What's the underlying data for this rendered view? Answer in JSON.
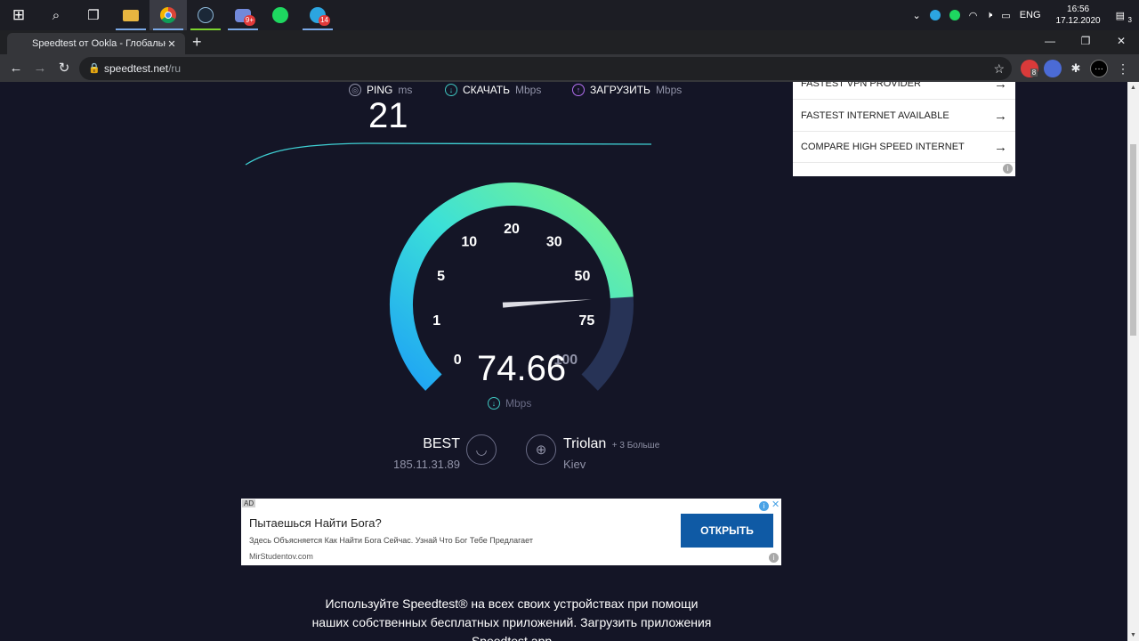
{
  "taskbar": {
    "apps": [
      {
        "name": "windows-start",
        "glyph": "⊞"
      },
      {
        "name": "search",
        "glyph": "⌕"
      },
      {
        "name": "task-view",
        "glyph": "❐"
      },
      {
        "name": "file-explorer",
        "glyph": "▬"
      },
      {
        "name": "chrome",
        "glyph": "◉"
      },
      {
        "name": "steam",
        "glyph": "♨"
      },
      {
        "name": "discord",
        "glyph": "◙",
        "badge": "9+"
      },
      {
        "name": "spotify",
        "glyph": "◍"
      },
      {
        "name": "telegram",
        "glyph": "➤",
        "badge": "14"
      }
    ],
    "tray": {
      "language": "ENG",
      "time": "16:56",
      "date": "17.12.2020",
      "notification_count": "3"
    }
  },
  "browser": {
    "tab_title": "Speedtest от Ookla - Глобальный",
    "url_host": "speedtest.net",
    "url_path": "/ru",
    "extension_badge": "8"
  },
  "speedtest": {
    "ping_label": "PING",
    "ping_unit": "ms",
    "download_label": "СКАЧАТЬ",
    "download_unit": "Mbps",
    "upload_label": "ЗАГРУЗИТЬ",
    "upload_unit": "Mbps",
    "ping_value": "21",
    "gauge_labels": [
      "0",
      "1",
      "5",
      "10",
      "20",
      "30",
      "50",
      "75",
      "100"
    ],
    "speed_value": "74.66",
    "speed_unit": "Mbps",
    "gauge_fill_fraction": 0.82,
    "isp_name": "BEST",
    "isp_ip": "185.11.31.89",
    "server_name": "Triolan",
    "server_more": "+ 3 Больше",
    "server_city": "Kiev"
  },
  "side_ad": {
    "items": [
      {
        "label": "FASTEST VPN PROVIDER"
      },
      {
        "label": "FASTEST INTERNET AVAILABLE"
      },
      {
        "label": "COMPARE HIGH SPEED INTERNET"
      }
    ]
  },
  "banner_ad": {
    "tag": "AD",
    "title": "Пытаешься Найти Бога?",
    "description": "Здесь Объясняется Как Найти Бога Сейчас. Узнай Что Бог Тебе Предлагает",
    "url": "MirStudentov.com",
    "cta": "ОТКРЫТЬ"
  },
  "promo": {
    "line1": "Используйте Speedtest® на всех своих устройствах при помощи",
    "line2": "наших собственных бесплатных приложений. Загрузить приложения",
    "line3": "Speedtest app"
  },
  "colors": {
    "page_bg": "#141526",
    "gauge_start": "#1fa6ff",
    "gauge_end": "#79f58a",
    "gauge_track": "#2a3458"
  }
}
